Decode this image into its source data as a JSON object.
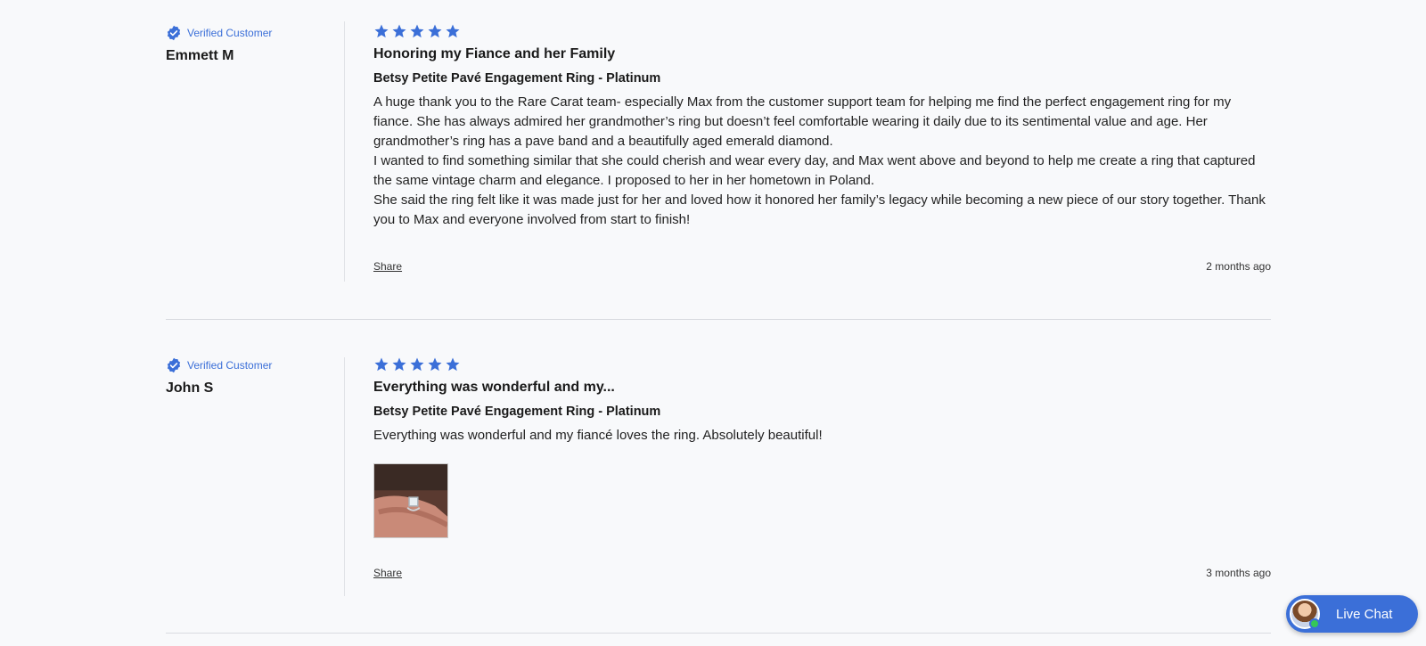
{
  "reviews": [
    {
      "verified_label": "Verified Customer",
      "customer": "Emmett M",
      "rating": 5,
      "title": "Honoring my Fiance and her Family",
      "product": "Betsy Petite Pavé Engagement Ring - Platinum",
      "body": [
        "A huge thank you to the Rare Carat team- especially Max from the customer support team for helping me find the perfect engagement ring for my fiance. She has always admired her grandmother’s ring but doesn’t feel comfortable wearing it daily due to its sentimental value and age. Her grandmother’s ring has a pave band and a beautifully aged emerald diamond.",
        "I wanted to find something similar that she could cherish and wear every day, and Max went above and beyond to help me create a ring that captured the same vintage charm and elegance. I proposed to her in her hometown in Poland.",
        "She said the ring felt like it was made just for her and loved how it honored her family’s legacy while becoming a new piece of our story together. Thank you to Max and everyone involved from start to finish!"
      ],
      "share_label": "Share",
      "time": "2 months ago"
    },
    {
      "verified_label": "Verified Customer",
      "customer": "John S",
      "rating": 5,
      "title": "Everything was wonderful and my...",
      "product": "Betsy Petite Pavé Engagement Ring - Platinum",
      "body": [
        "Everything was wonderful and my fiancé loves the ring. Absolutely beautiful!"
      ],
      "share_label": "Share",
      "time": "3 months ago"
    }
  ],
  "live_chat": {
    "label": "Live Chat"
  },
  "colors": {
    "accent": "#3b6fd8",
    "background": "#f8f9fb",
    "divider": "#d9dbe0"
  }
}
